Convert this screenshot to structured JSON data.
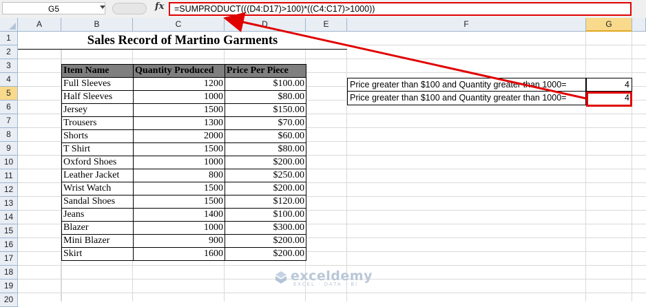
{
  "formula_bar": {
    "name_box": "G5",
    "fx_label": "fx",
    "formula": "=SUMPRODUCT(((D4:D17)>100)*((C4:C17)>1000))"
  },
  "columns": [
    "A",
    "B",
    "C",
    "D",
    "E",
    "F",
    "G"
  ],
  "active_column": "G",
  "rows": [
    "1",
    "2",
    "3",
    "4",
    "5",
    "6",
    "7",
    "8",
    "9",
    "10",
    "11",
    "12",
    "13",
    "14",
    "15",
    "16",
    "17",
    "18",
    "19",
    "20"
  ],
  "active_row": "5",
  "sheet": {
    "title": "Sales Record of Martino Garments",
    "table": {
      "headers": [
        "Item Name",
        "Quantity Produced",
        "Price Per Piece"
      ],
      "rows": [
        [
          "Full Sleeves",
          "1200",
          "$100.00"
        ],
        [
          "Half Sleeves",
          "1000",
          "$80.00"
        ],
        [
          "Jersey",
          "1500",
          "$150.00"
        ],
        [
          "Trousers",
          "1300",
          "$70.00"
        ],
        [
          "Shorts",
          "2000",
          "$60.00"
        ],
        [
          "T Shirt",
          "1500",
          "$80.00"
        ],
        [
          "Oxford Shoes",
          "1000",
          "$200.00"
        ],
        [
          "Leather Jacket",
          "800",
          "$250.00"
        ],
        [
          "Wrist Watch",
          "1500",
          "$200.00"
        ],
        [
          "Sandal Shoes",
          "1500",
          "$120.00"
        ],
        [
          "Jeans",
          "1400",
          "$100.00"
        ],
        [
          "Blazer",
          "1000",
          "$300.00"
        ],
        [
          "Mini Blazer",
          "900",
          "$200.00"
        ],
        [
          "Skirt",
          "1600",
          "$200.00"
        ]
      ]
    },
    "results": [
      {
        "label": "Price greater than $100 and Quantity greater than 1000=",
        "value": "4"
      },
      {
        "label": "Price greater than $100 and Quantity greater than 1000=",
        "value": "4"
      }
    ]
  },
  "watermark": {
    "main": "exceldemy",
    "sub": "EXCEL · DATA · BI"
  },
  "colors": {
    "highlight": "#e00000",
    "header_fill": "#7f7f7f",
    "active_header": "#f9d98b"
  }
}
